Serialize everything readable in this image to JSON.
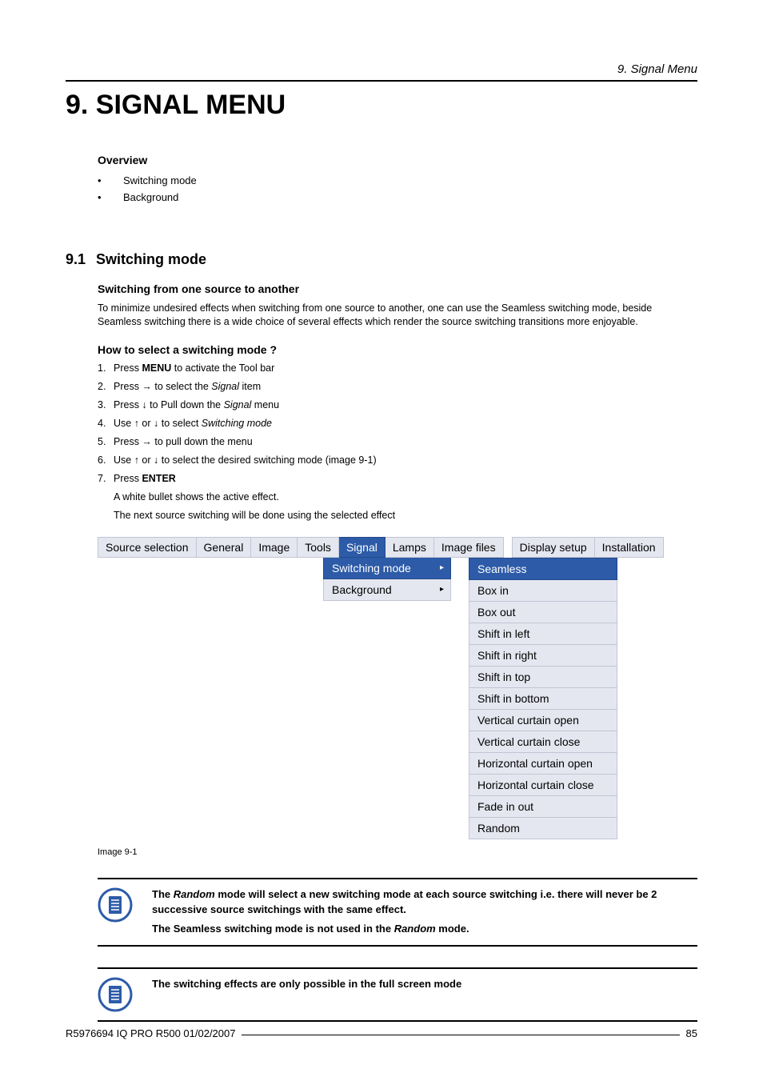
{
  "header": {
    "right": "9.  Signal Menu"
  },
  "chapter": {
    "title": "9.  SIGNAL MENU"
  },
  "overview": {
    "heading": "Overview",
    "items": [
      "Switching mode",
      "Background"
    ]
  },
  "section91": {
    "number": "9.1",
    "title": "Switching mode",
    "sub1": {
      "heading": "Switching from one source to another",
      "para": "To minimize undesired effects when switching from one source to another, one can use the Seamless switching mode, beside Seamless switching there is a wide choice of several effects which render the source switching transitions more enjoyable."
    },
    "sub2": {
      "heading": "How to select a switching mode ?",
      "steps": {
        "s1a": "Press ",
        "s1b": "MENU",
        "s1c": " to activate the Tool bar",
        "s2a": "Press → to select the ",
        "s2b": "Signal",
        "s2c": " item",
        "s3a": "Press ↓ to Pull down the ",
        "s3b": "Signal",
        "s3c": " menu",
        "s4a": "Use ↑ or ↓ to select ",
        "s4b": "Switching mode",
        "s5": "Press → to pull down the menu",
        "s6": "Use ↑ or ↓ to select the desired switching mode (image 9-1)",
        "s7a": "Press ",
        "s7b": "ENTER",
        "after1": "A white bullet shows the active effect.",
        "after2": "The next source switching will be done using the selected effect"
      }
    }
  },
  "menu": {
    "bar": [
      "Source selection",
      "General",
      "Image",
      "Tools",
      "Signal",
      "Lamps",
      "Image files",
      "Display setup",
      "Installation"
    ],
    "bar_selected_index": 4,
    "dropdown": [
      {
        "label": "Switching mode",
        "arrow": "▸",
        "selected": true
      },
      {
        "label": "Background",
        "arrow": "▸",
        "selected": false
      }
    ],
    "options": [
      "Seamless",
      "Box in",
      "Box out",
      "Shift in left",
      "Shift in right",
      "Shift in top",
      "Shift in bottom",
      "Vertical curtain open",
      "Vertical curtain close",
      "Horizontal curtain open",
      "Horizontal curtain close",
      "Fade in out",
      "Random"
    ],
    "options_selected_index": 0,
    "caption": "Image  9-1"
  },
  "notes": {
    "n1": {
      "line1a": "The ",
      "line1b": "Random",
      "line1c": " mode will select a new switching mode at each source switching i.e.  there will never be 2 successive source switchings with the same effect.",
      "line2a": "The Seamless switching mode is not used in the ",
      "line2b": "Random",
      "line2c": " mode."
    },
    "n2": {
      "text": "The switching effects are only possible in the full screen mode"
    }
  },
  "footer": {
    "left": "R5976694   IQ PRO R500   01/02/2007",
    "page": "85"
  }
}
